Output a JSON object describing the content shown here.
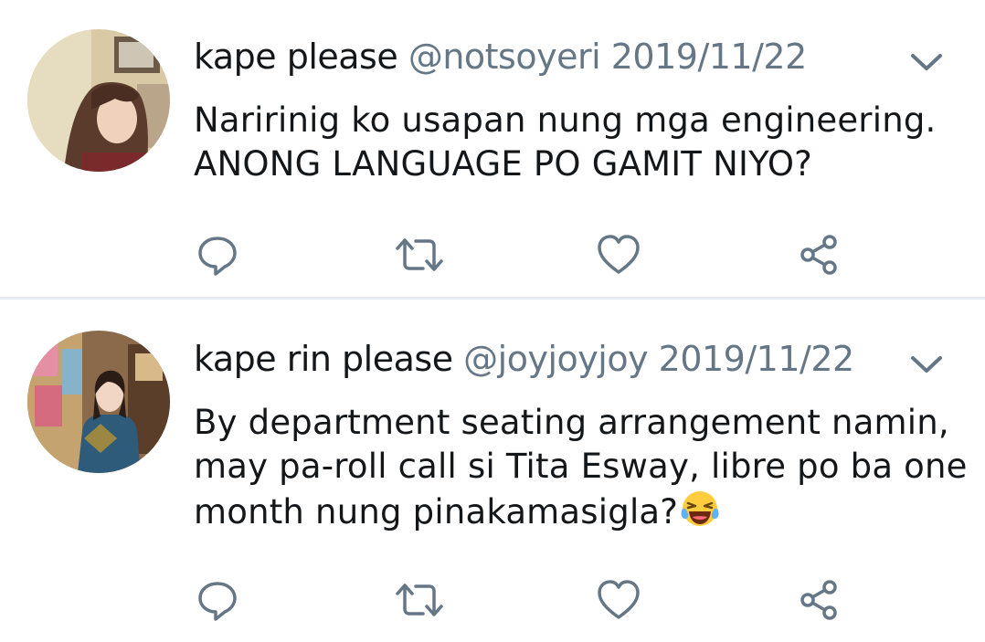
{
  "tweets": [
    {
      "name": "kape please",
      "handle": "@notsoyeri",
      "date": "2019/11/22",
      "text_lines": [
        "Naririnig ko usapan nung mga engineering.",
        "ANONG LANGUAGE PO GAMIT NIYO?"
      ],
      "has_emoji": false
    },
    {
      "name": "kape rin please",
      "handle": "@joyjoyjoy",
      "date": "2019/11/22",
      "text_lines": [
        "By department seating arrangement namin,",
        "may pa-roll call si Tita Esway, libre po ba one",
        "month nung pinakamasigla?"
      ],
      "has_emoji": true
    }
  ],
  "icons": {
    "menu": "chevron-down-icon",
    "reply": "reply-icon",
    "retweet": "retweet-icon",
    "like": "heart-icon",
    "share": "share-icon",
    "emoji": "laughing-tears-emoji-icon"
  },
  "colors": {
    "text": "#14171a",
    "secondary": "#657786",
    "icon": "#657786",
    "divider": "#e6ecf0"
  }
}
